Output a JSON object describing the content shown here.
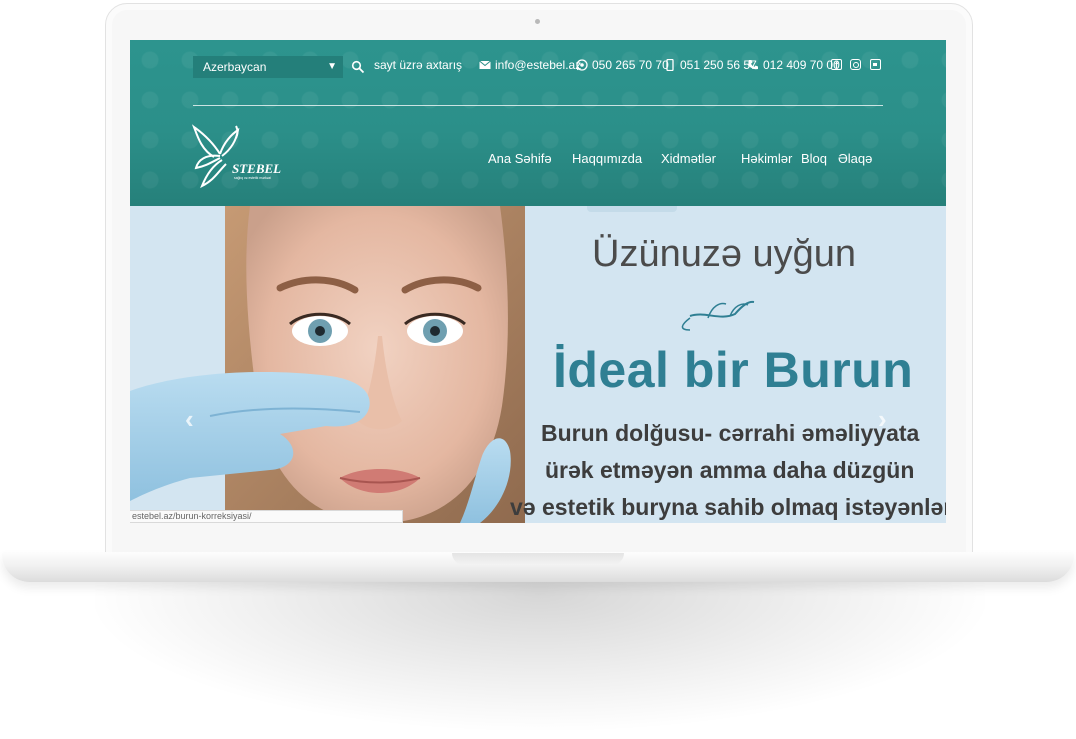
{
  "colors": {
    "header_teal": "#2b8f89",
    "title_teal": "#2f7f93",
    "hero_bg": "#d3e5f1"
  },
  "topbar": {
    "language": "Azerbaycan",
    "search_label": "sayt üzrə axtarış",
    "email": "info@estebel.az",
    "whatsapp": "050 265 70 70",
    "mobile": "051 250 56 57",
    "phone": "012 409 70 00",
    "icons": [
      "search-icon",
      "envelope-icon",
      "whatsapp-icon",
      "mobile-icon",
      "phone-icon",
      "facebook-icon",
      "instagram-icon",
      "youtube-icon"
    ]
  },
  "logo": {
    "name": "STEBEL",
    "tagline": "sağlıq və estetik mərkəzi"
  },
  "nav": [
    "Ana Səhifə",
    "Haqqımızda",
    "Xidmətlər",
    "Həkimlər",
    "Bloq",
    "Əlaqə"
  ],
  "hero": {
    "line1": "Üzünuzə uyğun",
    "line2": "İdeal bir Burun",
    "line3": "Burun dolğusu- cərrahi əməliyyata",
    "line4": "ürək etməyən amma daha düzgün",
    "line5": "və estetik burуna sahib olmaq istəyənlər"
  },
  "status_url": "estebel.az/burun-korreksiyasi/"
}
